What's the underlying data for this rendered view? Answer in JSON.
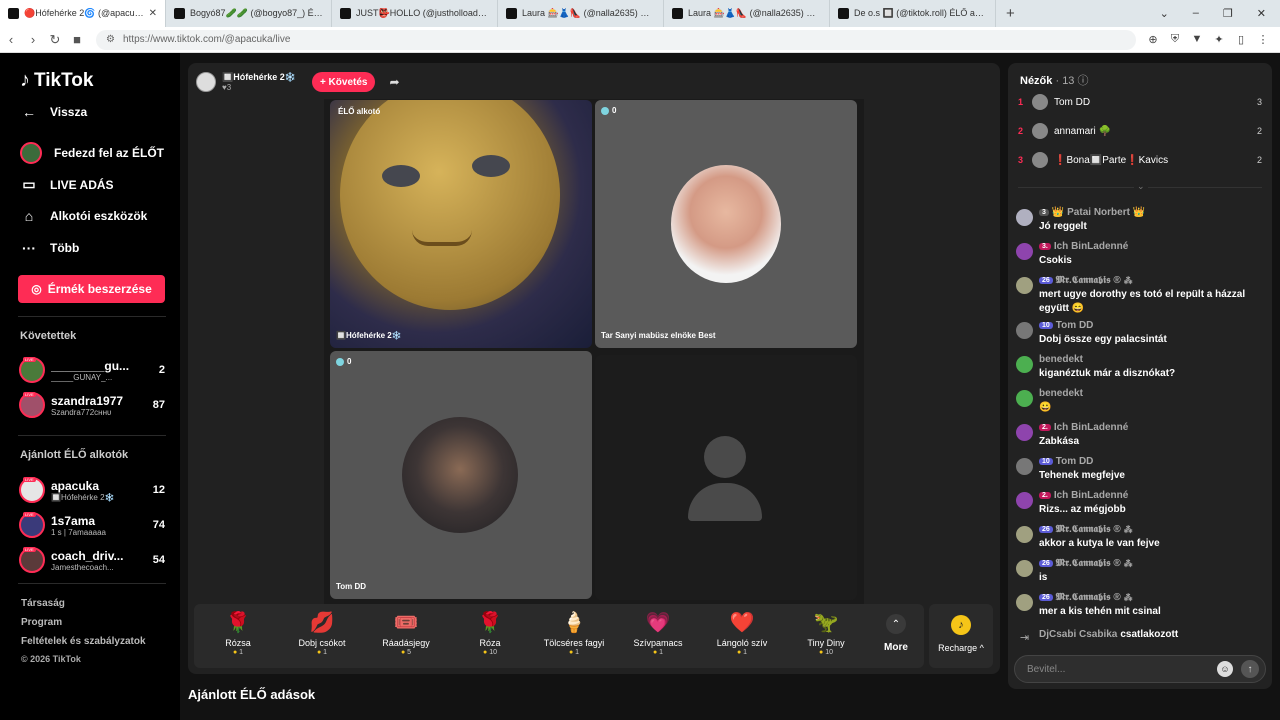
{
  "browser": {
    "tabs": [
      {
        "title": "🔴Hófehérke 2🌀 (@apacuka...",
        "active": true
      },
      {
        "title": "Bogyó87🥒🥒 (@bogyo87_) ÉLŐ a...",
        "active": false
      },
      {
        "title": "JUST👺HOLLO (@justholloadam) É...",
        "active": false
      },
      {
        "title": "Laura 🎰👗👠 (@nalla2635) ÉLŐ adá...",
        "active": false
      },
      {
        "title": "Laura 🎰👗👠 (@nalla2635) ÉLŐ adá...",
        "active": false
      },
      {
        "title": "De o.s 🔲 (@tiktok.roll) ÉLŐ adá...",
        "active": false
      }
    ],
    "url": "https://www.tiktok.com/@apacuka/live"
  },
  "sidebar": {
    "logo": "TikTok",
    "back": "Vissza",
    "nav": [
      {
        "label": "Fedezd fel az ÉLŐT",
        "icon": "explore-live-icon"
      },
      {
        "label": "LIVE ADÁS",
        "icon": "camera-icon"
      },
      {
        "label": "Alkotói eszközök",
        "icon": "creator-tools-icon"
      },
      {
        "label": "Több",
        "icon": "more-dots-icon"
      }
    ],
    "coins_button": "Érmék beszerzése",
    "following_title": "Követettek",
    "following": [
      {
        "name": "________gu...",
        "sub": "_____GUNAY_...",
        "count": "2",
        "color": "#4a7a3a"
      },
      {
        "name": "szandra1977",
        "sub": "Szandra772ᴄʜʜᴜ",
        "count": "87",
        "color": "#a0506a"
      }
    ],
    "recommended_title": "Ajánlott ÉLŐ alkotók",
    "recommended": [
      {
        "name": "apacuka",
        "sub": "🔲Hófehérke 2❄️",
        "count": "12",
        "color": "#e6e6e6"
      },
      {
        "name": "1s7ama",
        "sub": "1 s | 7amaaaaa",
        "count": "74",
        "color": "#3a3a7a"
      },
      {
        "name": "coach_driv...",
        "sub": "Jamesthecoach...",
        "count": "54",
        "color": "#5a3a3a"
      }
    ],
    "footer": [
      "Társaság",
      "Program",
      "Feltételek és szabályzatok"
    ],
    "copyright": "© 2026 TikTok"
  },
  "stage": {
    "host_name": "🔲Hófehérke 2❄️",
    "host_likes": "♥3",
    "follow_button": "+ Követés",
    "tiles": {
      "t1_tag": "ÉLŐ alkotó",
      "t1_label": "🔲Hófehérke 2❄️",
      "t2_count": "0",
      "t2_label": "Tar Sanyi mabüsz elnöke Best",
      "t3_count": "0",
      "t3_label": "Tom DD"
    },
    "gifts": [
      {
        "name": "Rózsa",
        "price": "1",
        "icon": "🌹"
      },
      {
        "name": "Dobj csókot",
        "price": "1",
        "icon": "💋"
      },
      {
        "name": "Ráadásjegy",
        "price": "5",
        "icon": "🎟️"
      },
      {
        "name": "Róza",
        "price": "10",
        "icon": "🌹"
      },
      {
        "name": "Tölcséres fagyi",
        "price": "1",
        "icon": "🍦"
      },
      {
        "name": "Szívpamacs",
        "price": "1",
        "icon": "💗"
      },
      {
        "name": "Lángoló szív",
        "price": "1",
        "icon": "❤️"
      },
      {
        "name": "Tiny Diny",
        "price": "10",
        "icon": "🦖"
      }
    ],
    "more_label": "More",
    "recharge_label": "Recharge ^",
    "recommended_heading": "Ajánlott ÉLŐ adások"
  },
  "chat": {
    "viewers_label": "Nézők",
    "viewers_count": "· 13",
    "top_viewers": [
      {
        "rank": "1",
        "name": "Tom DD",
        "score": "3"
      },
      {
        "rank": "2",
        "name": "annamari 🌳",
        "score": "2"
      },
      {
        "rank": "3",
        "name": "❗Bona🔲Parte❗Kavics",
        "score": "2"
      }
    ],
    "messages": [
      {
        "name": "👑 Patai Norbert 👑",
        "badge": "3",
        "badge_color": "gray",
        "text": "Jó reggelt",
        "av_color": "#b0b0c0"
      },
      {
        "name": "Ich BinLadenné",
        "badge": "3.",
        "badge_color": "pink",
        "text": "Csokis",
        "av_color": "#8e44ad"
      },
      {
        "name": "𝕸𝖗.𝕮𝖆𝖓𝖓𝖆𝖇𝖎𝖘 ® ⁂",
        "badge": "26",
        "badge_color": "blue",
        "text": "mert ugye dorothy es totó el repült a házzal együtt 😄",
        "av_color": "#a0a080"
      },
      {
        "name": "Tom DD",
        "badge": "10",
        "badge_color": "blue",
        "text": "Dobj össze egy palacsintát",
        "av_color": "#777"
      },
      {
        "name": "benedekt",
        "badge": "",
        "badge_color": "",
        "text": "kiganéztuk már a disznókat?",
        "av_color": "#4caf50"
      },
      {
        "name": "benedekt",
        "badge": "",
        "badge_color": "",
        "text": "😀",
        "av_color": "#4caf50"
      },
      {
        "name": "Ich BinLadenné",
        "badge": "2.",
        "badge_color": "pink",
        "text": "Zabkása",
        "av_color": "#8e44ad"
      },
      {
        "name": "Tom DD",
        "badge": "10",
        "badge_color": "blue",
        "text": "Tehenek megfejve",
        "av_color": "#777"
      },
      {
        "name": "Ich BinLadenné",
        "badge": "2.",
        "badge_color": "pink",
        "text": "Rizs... az mégjobb",
        "av_color": "#8e44ad"
      },
      {
        "name": "𝕸𝖗.𝕮𝖆𝖓𝖓𝖆𝖇𝖎𝖘 ® ⁂",
        "badge": "26",
        "badge_color": "blue",
        "text": "akkor a kutya le van fejve",
        "av_color": "#a0a080"
      },
      {
        "name": "𝕸𝖗.𝕮𝖆𝖓𝖓𝖆𝖇𝖎𝖘 ® ⁂",
        "badge": "26",
        "badge_color": "blue",
        "text": "is",
        "av_color": "#a0a080"
      },
      {
        "name": "𝕸𝖗.𝕮𝖆𝖓𝖓𝖆𝖇𝖎𝖘 ® ⁂",
        "badge": "26",
        "badge_color": "blue",
        "text": "mer a kis tehén mit csinal",
        "av_color": "#a0a080"
      }
    ],
    "join_name": "DjCsabi Csabika",
    "join_text": "csatlakozott",
    "input_placeholder": "Bevitel..."
  }
}
